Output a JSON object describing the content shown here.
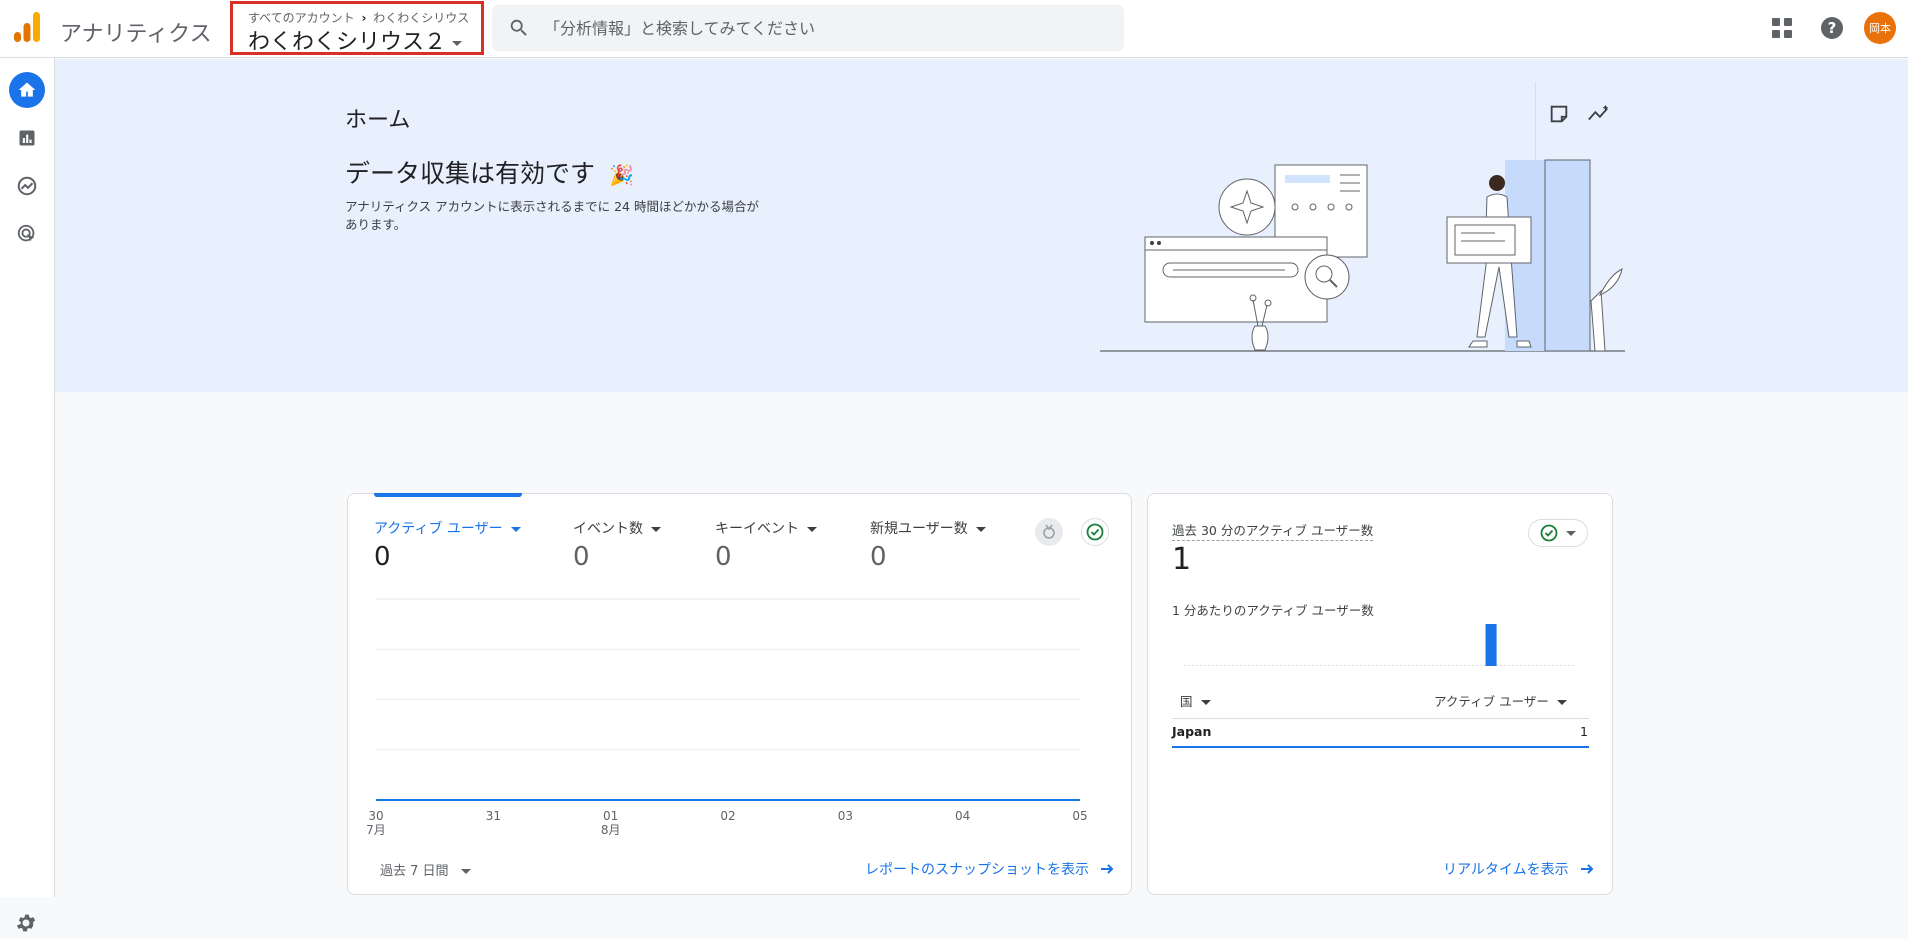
{
  "app": {
    "title": "アナリティクス",
    "breadcrumb_all": "すべてのアカウント",
    "breadcrumb_sep": "›",
    "breadcrumb_account": "わくわくシリウス",
    "property_name": "わくわくシリウス２",
    "search_placeholder": "「分析情報」と検索してみてください",
    "avatar_text": "岡本",
    "accent_color": "#1a73e8",
    "highlight_color": "#d93025"
  },
  "rail": {
    "items": [
      {
        "icon": "home-icon",
        "active": true
      },
      {
        "icon": "reports-icon",
        "active": false
      },
      {
        "icon": "explore-icon",
        "active": false
      },
      {
        "icon": "advertising-icon",
        "active": false
      }
    ],
    "settings_icon": "gear-icon"
  },
  "hero": {
    "home_title": "ホーム",
    "headline": "データ収集は有効です",
    "emoji": "🎉",
    "description": "アナリティクス アカウントに表示されるまでに 24 時間ほどかかる場合があります。"
  },
  "overview_card": {
    "metrics": [
      {
        "label": "アクティブ ユーザー",
        "value": "0",
        "active": true
      },
      {
        "label": "イベント数",
        "value": "0",
        "active": false
      },
      {
        "label": "キーイベント",
        "value": "0",
        "active": false
      },
      {
        "label": "新規ユーザー数",
        "value": "0",
        "active": false
      }
    ],
    "date_range": "過去 7 日間",
    "link": "レポートのスナップショットを表示"
  },
  "chart_data": {
    "type": "line",
    "x": [
      "30\n7月",
      "31",
      "01\n8月",
      "02",
      "03",
      "04",
      "05"
    ],
    "tick_labels": [
      {
        "top": "30",
        "bottom": "7月"
      },
      {
        "top": "31",
        "bottom": ""
      },
      {
        "top": "01",
        "bottom": "8月"
      },
      {
        "top": "02",
        "bottom": ""
      },
      {
        "top": "03",
        "bottom": ""
      },
      {
        "top": "04",
        "bottom": ""
      },
      {
        "top": "05",
        "bottom": ""
      }
    ],
    "series": [
      {
        "values": [
          0,
          0,
          0,
          0,
          0,
          0,
          0
        ]
      }
    ],
    "ylim": [
      0,
      4
    ],
    "grid": true,
    "title": "",
    "xlabel": "",
    "ylabel": ""
  },
  "realtime_card": {
    "title": "過去 30 分のアクティブ ユーザー数",
    "value": "1",
    "subtitle": "1 分あたりのアクティブ ユーザー数",
    "per_minute": [
      0,
      0,
      0,
      0,
      0,
      0,
      0,
      0,
      0,
      0,
      0,
      0,
      0,
      0,
      0,
      0,
      0,
      0,
      0,
      0,
      0,
      0,
      0,
      1,
      0,
      0,
      0,
      0,
      0,
      0
    ],
    "col_country": "国",
    "col_users": "アクティブ ユーザー",
    "rows": [
      {
        "country": "Japan",
        "users": "1"
      }
    ],
    "link": "リアルタイムを表示"
  }
}
